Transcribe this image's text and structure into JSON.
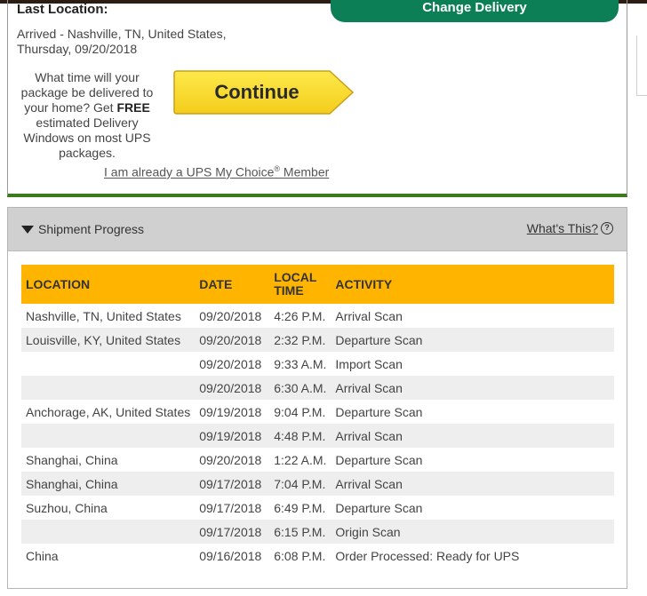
{
  "summary": {
    "last_location_label": "Last Location:",
    "arrived_line1": "Arrived - Nashville, TN, United States,",
    "arrived_line2": "Thursday, 09/20/2018",
    "change_delivery_label": "Change Delivery",
    "promo_part1": "What time will your package be delivered to your home? Get ",
    "promo_bold": "FREE",
    "promo_part2": " estimated Delivery Windows on most UPS packages.",
    "continue_label": "Continue",
    "member_link_pre": "I am already a UPS My Choice",
    "member_link_reg": "®",
    "member_link_post": " Member"
  },
  "progress": {
    "title": "Shipment Progress",
    "whats_this_label": "What's This?",
    "help_icon": "question-circle-icon",
    "columns": {
      "location": "LOCATION",
      "date": "DATE",
      "local_time_1": "LOCAL",
      "local_time_2": "TIME",
      "activity": "ACTIVITY"
    },
    "rows": [
      {
        "location": "Nashville,  TN,  United States",
        "date": "09/20/2018",
        "time": "4:26 P.M.",
        "activity": "Arrival Scan"
      },
      {
        "location": "Louisville,  KY,  United States",
        "date": "09/20/2018",
        "time": "2:32 P.M.",
        "activity": "Departure Scan"
      },
      {
        "location": "",
        "date": "09/20/2018",
        "time": "9:33 A.M.",
        "activity": "Import Scan"
      },
      {
        "location": "",
        "date": "09/20/2018",
        "time": "6:30 A.M.",
        "activity": "Arrival Scan"
      },
      {
        "location": "Anchorage,  AK,  United States",
        "date": "09/19/2018",
        "time": "9:04 P.M.",
        "activity": "Departure Scan"
      },
      {
        "location": "",
        "date": "09/19/2018",
        "time": "4:48 P.M.",
        "activity": "Arrival Scan"
      },
      {
        "location": "Shanghai,  China",
        "date": "09/20/2018",
        "time": "1:22 A.M.",
        "activity": "Departure Scan"
      },
      {
        "location": "Shanghai,  China",
        "date": "09/17/2018",
        "time": "7:04 P.M.",
        "activity": "Arrival Scan"
      },
      {
        "location": "Suzhou,  China",
        "date": "09/17/2018",
        "time": "6:49 P.M.",
        "activity": "Departure Scan"
      },
      {
        "location": "",
        "date": "09/17/2018",
        "time": "6:15 P.M.",
        "activity": "Origin Scan"
      },
      {
        "location": "China",
        "date": "09/16/2018",
        "time": "6:08 P.M.",
        "activity": "Order Processed: Ready for UPS"
      }
    ]
  },
  "colors": {
    "brand_green": "#0d7f56",
    "panel_green": "#3c7a1f",
    "header_gold": "#ffb500",
    "button_yellow": "#f8dc30"
  }
}
